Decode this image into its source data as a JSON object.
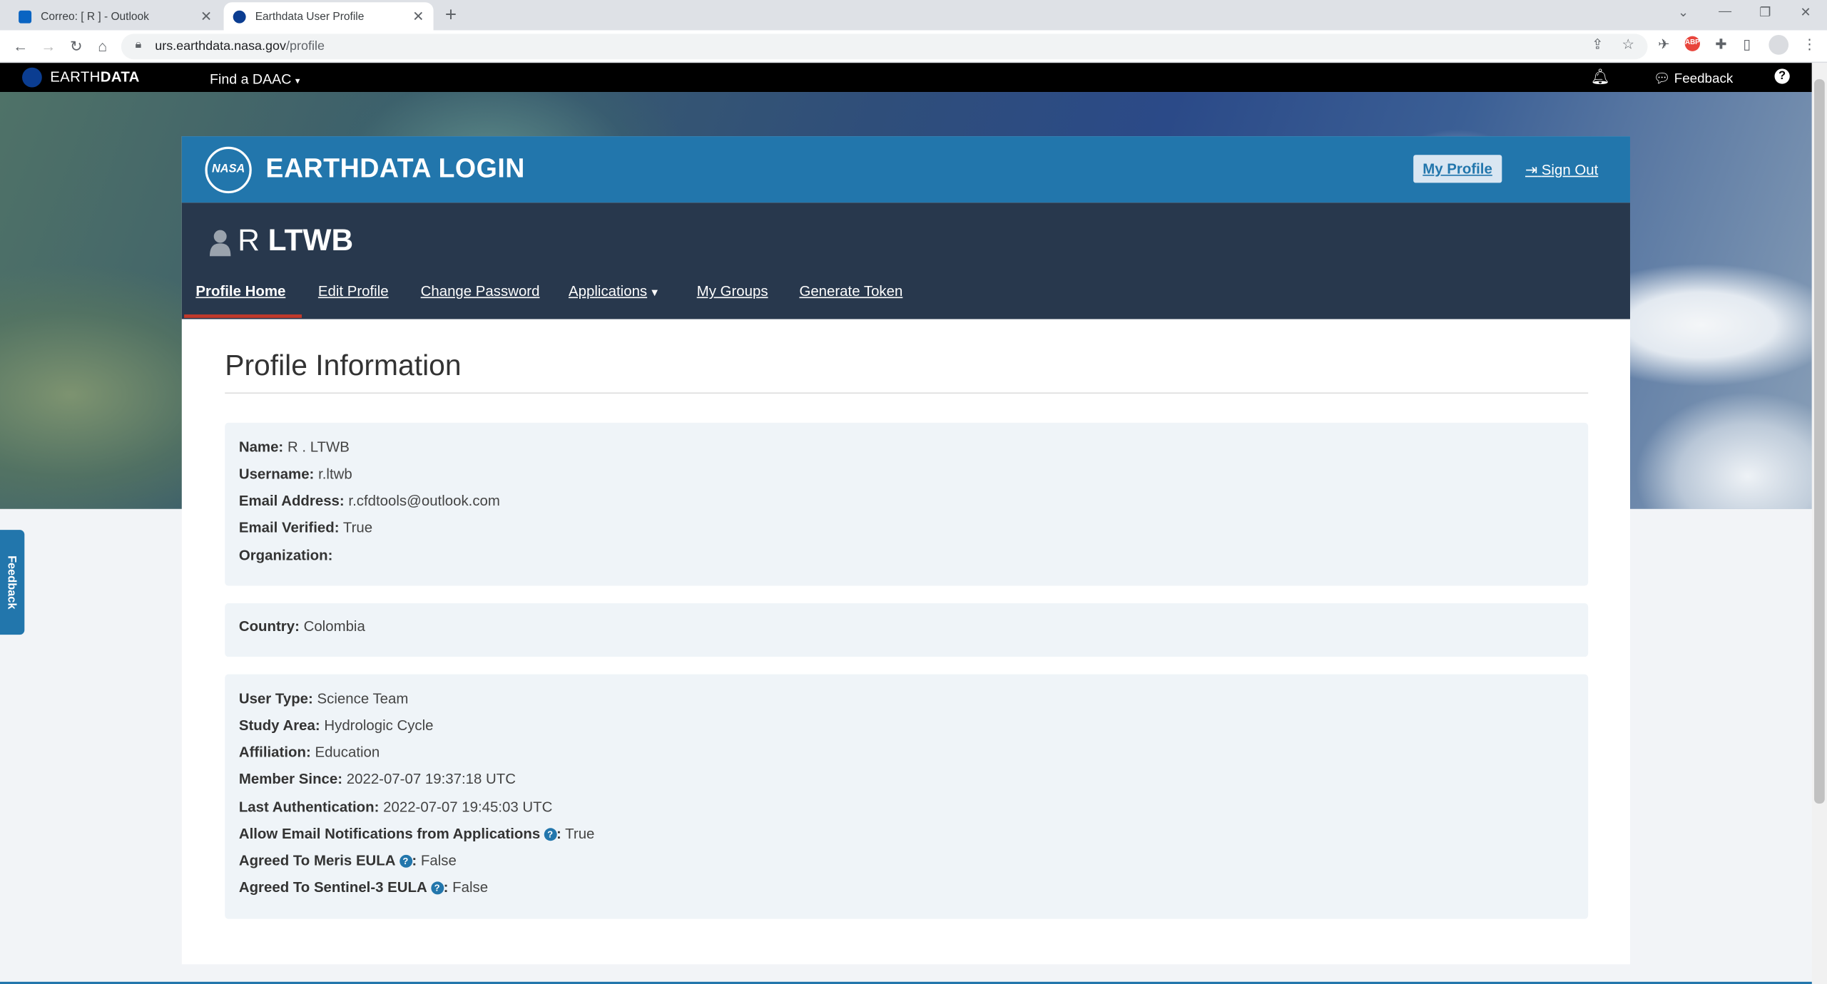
{
  "browser": {
    "tabs": [
      {
        "title": "Correo: [ R ] - Outlook",
        "icon": "outlook-icon"
      },
      {
        "title": "Earthdata User Profile",
        "icon": "nasa-icon"
      }
    ],
    "url_host": "urs.earthdata.nasa.gov",
    "url_path": "/profile"
  },
  "topbar": {
    "brand_light": "EARTH",
    "brand_bold": "DATA",
    "find_daac": "Find a DAAC",
    "feedback": "Feedback"
  },
  "side_feedback": "Feedback",
  "login_header": {
    "title": "EARTHDATA LOGIN",
    "my_profile": "My Profile",
    "sign_out": "Sign Out"
  },
  "user": {
    "first": "R",
    "last": "LTWB"
  },
  "nav_tabs": [
    "Profile Home",
    "Edit Profile",
    "Change Password",
    "Applications",
    "My Groups",
    "Generate Token"
  ],
  "page_title": "Profile Information",
  "sections": [
    [
      {
        "label": "Name:",
        "value": "R . LTWB"
      },
      {
        "label": "Username:",
        "value": "r.ltwb"
      },
      {
        "label": "Email Address:",
        "value": "r.cfdtools@outlook.com"
      },
      {
        "label": "Email Verified:",
        "value": "True"
      },
      {
        "label": "Organization:",
        "value": ""
      }
    ],
    [
      {
        "label": "Country:",
        "value": "Colombia"
      }
    ],
    [
      {
        "label": "User Type:",
        "value": "Science Team"
      },
      {
        "label": "Study Area:",
        "value": "Hydrologic Cycle"
      },
      {
        "label": "Affiliation:",
        "value": "Education"
      },
      {
        "label": "Member Since:",
        "value": "2022-07-07 19:37:18 UTC"
      },
      {
        "label": "Last Authentication:",
        "value": "2022-07-07 19:45:03 UTC"
      },
      {
        "label": "Allow Email Notifications from Applications",
        "value": "True"
      },
      {
        "label": "Agreed To Meris EULA",
        "value": "False"
      },
      {
        "label": "Agreed To Sentinel-3 EULA",
        "value": "False"
      }
    ]
  ],
  "colors": {
    "brand_blue": "#2276ac",
    "user_bar": "#28384d",
    "active_tab": "#c0392b"
  }
}
